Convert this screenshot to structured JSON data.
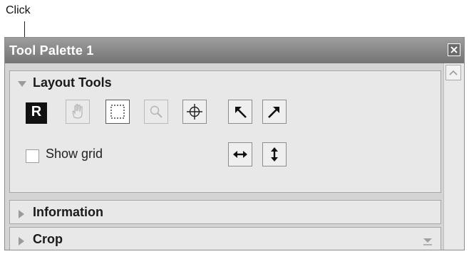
{
  "annotation": {
    "label": "Click"
  },
  "window": {
    "title": "Tool Palette 1",
    "close_icon": "close-icon"
  },
  "sections": {
    "layout": {
      "title": "Layout Tools",
      "expanded": true
    },
    "information": {
      "title": "Information",
      "expanded": false
    },
    "crop": {
      "title": "Crop",
      "expanded": false
    }
  },
  "tools": [
    {
      "name": "r-tool",
      "label": "R"
    },
    {
      "name": "hand-tool-icon"
    },
    {
      "name": "marquee-tool-icon",
      "state": "pressed"
    },
    {
      "name": "zoom-tool-icon"
    },
    {
      "name": "crosshair-tool-icon"
    },
    {
      "name": "rotate-left-icon"
    },
    {
      "name": "rotate-right-icon"
    },
    {
      "name": "flip-horizontal-icon"
    },
    {
      "name": "flip-vertical-icon"
    }
  ],
  "options": {
    "show_grid_label": "Show grid",
    "show_grid_checked": false
  }
}
